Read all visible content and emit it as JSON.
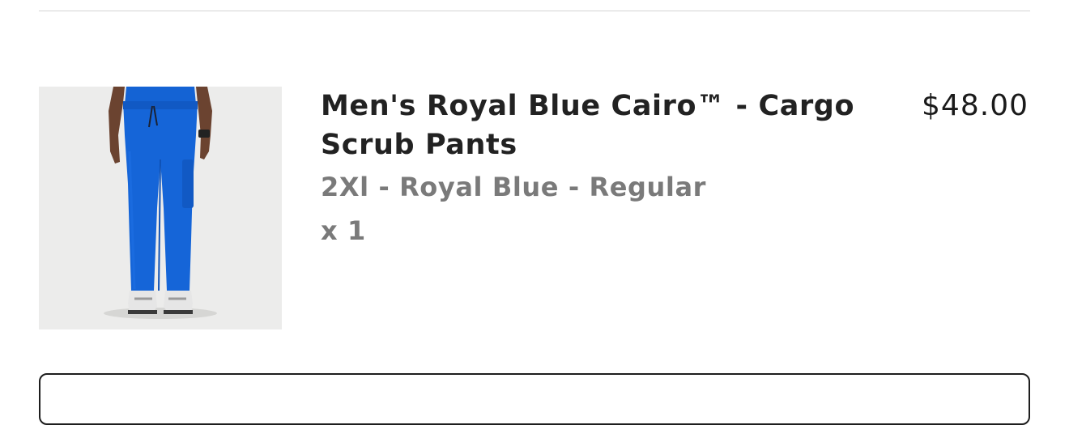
{
  "cart_item": {
    "image_alt": "product-image",
    "title": "Men's Royal Blue Cairo™ - Cargo Scrub Pants",
    "variant": "2Xl - Royal Blue - Regular",
    "quantity": "x 1",
    "price": "$48.00",
    "product_color": "#1565d8"
  }
}
